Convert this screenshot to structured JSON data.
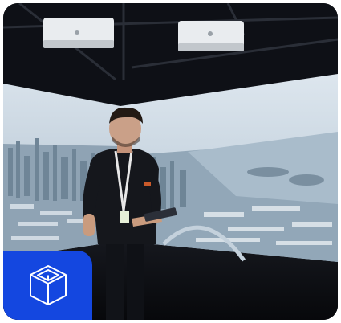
{
  "photo": {
    "subject": "person-operating-tablet-in-immersive-projection-room",
    "colors": {
      "screen_sky": "#c9d6e2",
      "city": "#8ea3b5",
      "room": "#0b0d12",
      "badge": "#1447e0"
    }
  },
  "badge": {
    "icon": "cube-icon"
  }
}
